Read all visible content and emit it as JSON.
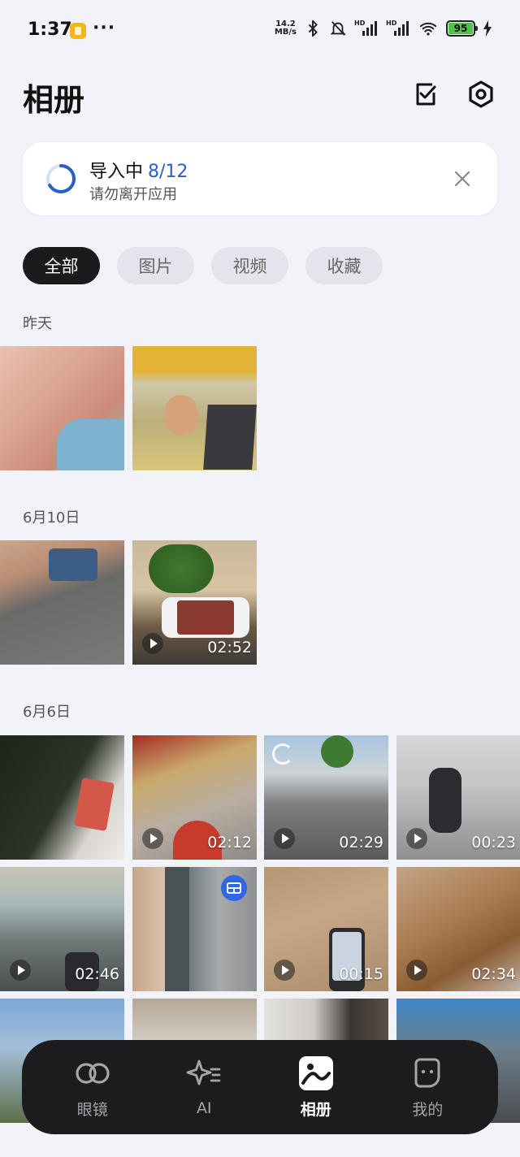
{
  "status_bar": {
    "time": "1:37",
    "more": "···",
    "speed_value": "14.2",
    "speed_unit": "MB/s",
    "hd_label": "HD",
    "battery": "95"
  },
  "header": {
    "title": "相册"
  },
  "import": {
    "title": "导入中",
    "count": "8/12",
    "subtitle": "请勿离开应用",
    "progress": 0.667
  },
  "tabs": [
    "全部",
    "图片",
    "视频",
    "收藏"
  ],
  "sections": [
    {
      "date": "昨天",
      "items": [
        {
          "type": "photo",
          "duration": ""
        },
        {
          "type": "photo",
          "duration": ""
        }
      ]
    },
    {
      "date": "6月10日",
      "items": [
        {
          "type": "photo",
          "duration": ""
        },
        {
          "type": "video",
          "duration": "02:52"
        }
      ]
    },
    {
      "date": "6月6日",
      "items": [
        {
          "type": "photo",
          "duration": ""
        },
        {
          "type": "video",
          "duration": "02:12"
        },
        {
          "type": "video",
          "duration": "02:29"
        },
        {
          "type": "video",
          "duration": "00:23"
        },
        {
          "type": "video",
          "duration": "02:46"
        },
        {
          "type": "photo",
          "duration": ""
        },
        {
          "type": "video",
          "duration": "00:15"
        },
        {
          "type": "video",
          "duration": "02:34"
        }
      ]
    }
  ],
  "bottom_nav": [
    {
      "label": "眼镜",
      "icon": "glasses-icon",
      "active": false
    },
    {
      "label": "AI",
      "icon": "sparkle-icon",
      "active": false
    },
    {
      "label": "相册",
      "icon": "album-icon",
      "active": true
    },
    {
      "label": "我的",
      "icon": "profile-icon",
      "active": false
    }
  ],
  "colors": {
    "accent": "#2a5fc9",
    "background": "#f2f3f8",
    "active_tab": "#1b1b1d"
  }
}
